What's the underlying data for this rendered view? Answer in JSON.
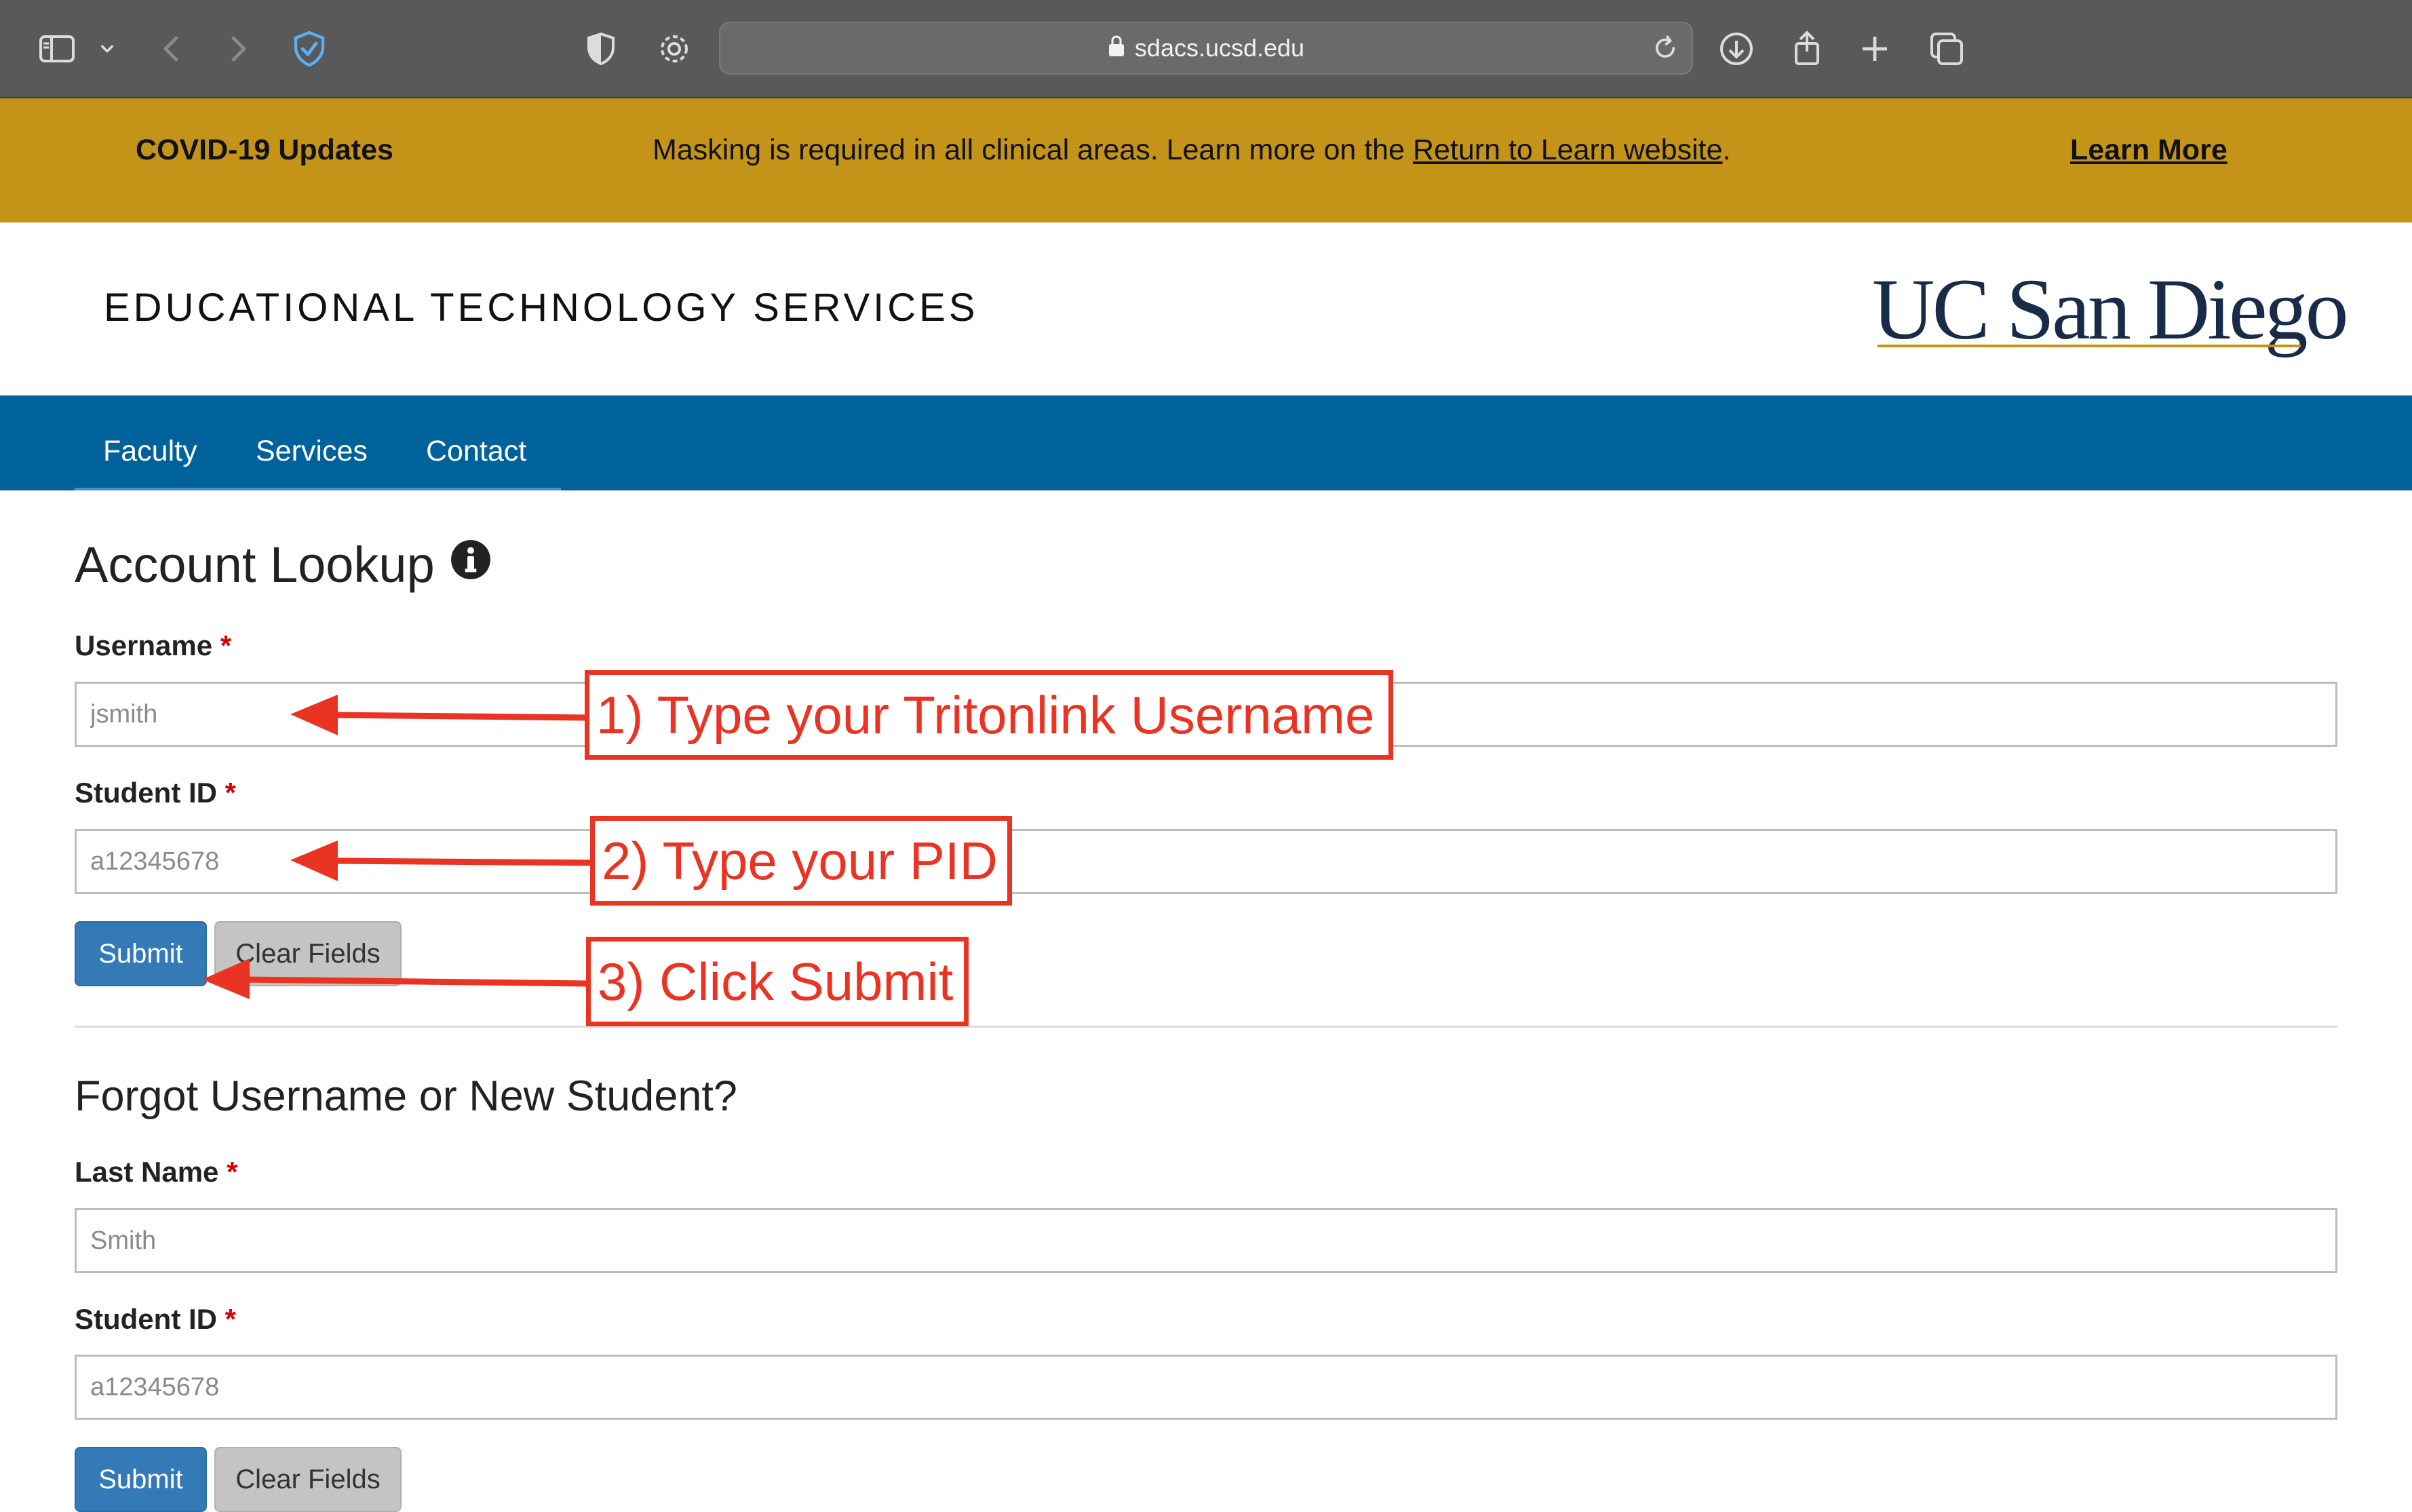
{
  "browser": {
    "url": "sdacs.ucsd.edu",
    "icons": [
      "sidebar-icon",
      "chevron-down-icon",
      "back-icon",
      "forward-icon",
      "privacy-shield-icon",
      "half-shield-icon",
      "gear-icon",
      "lock-icon",
      "reload-icon",
      "download-icon",
      "share-icon",
      "new-tab-icon",
      "tabs-overview-icon"
    ]
  },
  "banner": {
    "title": "COVID-19 Updates",
    "message_prefix": "Masking is required in all clinical areas. Learn more on the ",
    "message_link": "Return to Learn website",
    "message_suffix": ".",
    "learn_more": "Learn More",
    "color": "#c49419"
  },
  "header": {
    "site_title": "EDUCATIONAL TECHNOLOGY SERVICES",
    "logo_text": "UC San Diego",
    "logo_color": "#182b49",
    "logo_accent": "#c69214"
  },
  "nav": {
    "items": [
      "Faculty",
      "Services",
      "Contact"
    ],
    "color": "#00629b"
  },
  "lookup": {
    "title": "Account Lookup",
    "info_icon": "info-circle-icon",
    "username_label": "Username",
    "username_placeholder": "jsmith",
    "student_id_label": "Student ID",
    "student_id_placeholder": "a12345678",
    "submit": "Submit",
    "clear": "Clear Fields",
    "required_mark": "*"
  },
  "forgot": {
    "title": "Forgot Username or New Student?",
    "last_name_label": "Last Name",
    "last_name_placeholder": "Smith",
    "student_id_label": "Student ID",
    "student_id_placeholder": "a12345678",
    "submit": "Submit",
    "clear": "Clear Fields",
    "required_mark": "*"
  },
  "annotations": {
    "step1": "1) Type your Tritonlink Username",
    "step2": "2) Type your PID",
    "step3": "3) Click Submit",
    "color": "#ea3323"
  }
}
